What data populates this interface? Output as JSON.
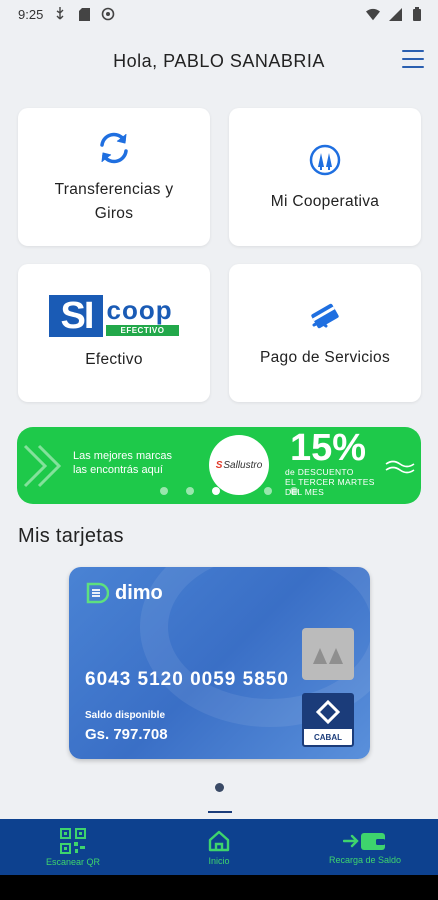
{
  "status_bar": {
    "time": "9:25"
  },
  "header": {
    "greeting": "Hola, PABLO SANABRIA"
  },
  "services": [
    {
      "label_line1": "Transferencias y",
      "label_line2": "Giros",
      "icon": "refresh-icon"
    },
    {
      "label_line1": "Mi Cooperativa",
      "label_line2": "",
      "icon": "cooperative-icon"
    },
    {
      "label_line1": "Efectivo",
      "label_line2": "",
      "icon": "sicoop-logo"
    },
    {
      "label_line1": "Pago de Servicios",
      "label_line2": "",
      "icon": "card-payment-icon"
    }
  ],
  "sicoop_logo": {
    "si": "SI",
    "coop": "coop",
    "tag": "EFECTIVO"
  },
  "banner": {
    "text_line1": "Las mejores marcas",
    "text_line2": "las encontrás aquí",
    "brand": "Sallustro",
    "percent": "15%",
    "sub_line1": "de DESCUENTO",
    "sub_line2": "EL TERCER MARTES",
    "sub_line3": "DEL MES",
    "slides": 6,
    "active_slide": 3
  },
  "cards_section": {
    "title": "Mis tarjetas"
  },
  "card": {
    "brand": "dimo",
    "number": "6043 5120 0059 5850",
    "balance_label": "Saldo disponible",
    "balance": "Gs. 797.708",
    "network": "CABAL"
  },
  "bottom_nav": [
    {
      "label": "Escanear QR",
      "icon": "qr-code-icon"
    },
    {
      "label": "Inicio",
      "icon": "home-icon"
    },
    {
      "label": "Recarga de Saldo",
      "icon": "wallet-icon"
    }
  ],
  "colors": {
    "accent_blue": "#2a5fb0",
    "nav_bg": "#0d418f",
    "nav_green": "#3ed46d",
    "banner_green": "#1ec94a"
  }
}
